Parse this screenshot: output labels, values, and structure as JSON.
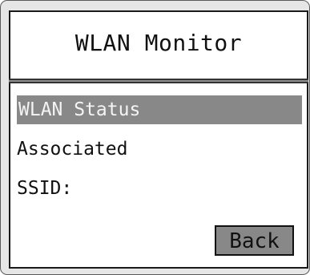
{
  "screen": {
    "title": "WLAN Monitor"
  },
  "list": {
    "selected_item": "WLAN Status",
    "association_status": "Associated",
    "ssid_label": "SSID:"
  },
  "actions": {
    "back_label": "Back"
  },
  "colors": {
    "frame": "#e6e6e6",
    "screen_bg": "#ffffff",
    "highlight": "#888888",
    "highlight_text": "#f4f4f4",
    "text": "#111111"
  }
}
